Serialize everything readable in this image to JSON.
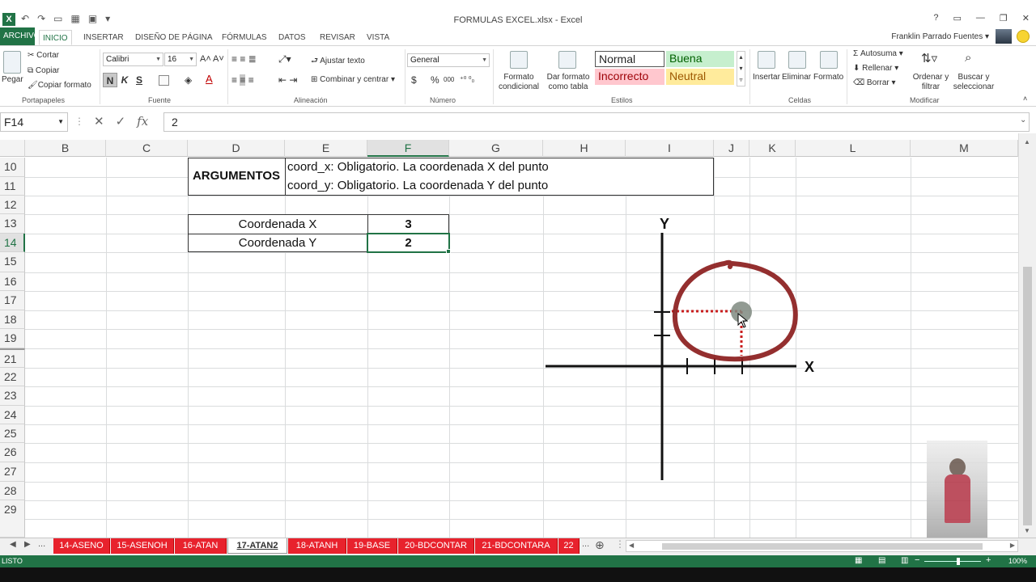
{
  "window": {
    "title": "FORMULAS EXCEL.xlsx - Excel",
    "app_logo": "X",
    "controls": [
      "?",
      "▭",
      "—",
      "❐",
      "✕"
    ]
  },
  "ribbon_tabs": [
    "ARCHIVO",
    "INICIO",
    "INSERTAR",
    "DISEÑO DE PÁGINA",
    "FÓRMULAS",
    "DATOS",
    "REVISAR",
    "VISTA"
  ],
  "user": {
    "name": "Franklin Parrado Fuentes ▾"
  },
  "clipboard": {
    "paste": "Pegar",
    "cut": "Cortar",
    "copy": "Copiar",
    "format_painter": "Copiar formato",
    "label": "Portapapeles"
  },
  "font": {
    "name": "Calibri",
    "size": "16",
    "label": "Fuente",
    "bold": "N",
    "italic": "K",
    "underline": "S"
  },
  "alignment": {
    "wrap": "Ajustar texto",
    "merge": "Combinar y centrar",
    "label": "Alineación"
  },
  "number": {
    "format": "General",
    "label": "Número",
    "currency": "$",
    "percent": "%",
    "thousands": "000"
  },
  "styles": {
    "conditional": "Formato condicional",
    "as_table": "Dar formato como tabla",
    "normal": "Normal",
    "good": "Buena",
    "bad": "Incorrecto",
    "neutral": "Neutral",
    "label": "Estilos"
  },
  "cells_group": {
    "insert": "Insertar",
    "delete": "Eliminar",
    "format": "Formato",
    "label": "Celdas"
  },
  "editing": {
    "autosum": "Autosuma",
    "fill": "Rellenar",
    "clear": "Borrar",
    "sort": "Ordenar y filtrar",
    "find": "Buscar y seleccionar",
    "label": "Modificar"
  },
  "formula_bar": {
    "name_box": "F14",
    "value": "2",
    "fx": "fx"
  },
  "columns": [
    "B",
    "C",
    "D",
    "E",
    "F",
    "G",
    "H",
    "I",
    "J",
    "K",
    "L",
    "M"
  ],
  "rows": [
    "10",
    "11",
    "12",
    "13",
    "14",
    "15",
    "16",
    "17",
    "18",
    "19",
    "21",
    "22",
    "23",
    "24",
    "25",
    "26",
    "27",
    "28",
    "29"
  ],
  "sheet": {
    "arg_header": "ARGUMENTOS",
    "arg_x": "coord_x: Obligatorio. La coordenada X del punto",
    "arg_y": "coord_y: Obligatorio. La coordenada Y del punto",
    "label_x": "Coordenada X",
    "label_y": "Coordenada Y",
    "value_x": "3",
    "value_y": "2"
  },
  "diagram": {
    "y_label": "Y",
    "x_label": "X"
  },
  "sheet_tabs": [
    "14-ASENO",
    "15-ASENOH",
    "16-ATAN",
    "17-ATAN2",
    "18-ATANH",
    "19-BASE",
    "20-BDCONTAR",
    "21-BDCONTARA",
    "22"
  ],
  "sheet_tabs_more": "...",
  "status": {
    "ready": "LISTO",
    "zoom": "100%"
  },
  "colors": {
    "excel_green": "#217346",
    "sheet_tab_red": "#e8222d",
    "annotation_red": "#8b1d1d"
  }
}
